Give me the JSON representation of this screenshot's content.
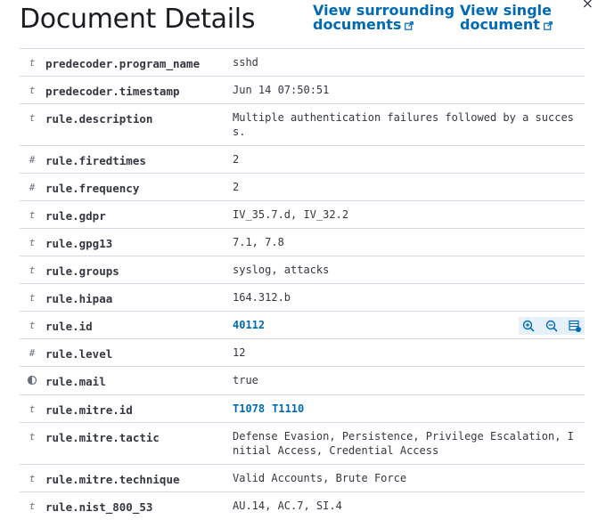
{
  "header": {
    "title": "Document Details",
    "surrounding_link_l1": "View surrounding",
    "surrounding_link_l2": "documents",
    "single_link_l1": "View single",
    "single_link_l2": "document",
    "close_label": "×"
  },
  "colors": {
    "link": "#006bb4",
    "divider": "#d3dae6",
    "text": "#343741"
  },
  "rows": [
    {
      "type": "t",
      "name": "predecoder.program_name",
      "value": "sshd"
    },
    {
      "type": "t",
      "name": "predecoder.timestamp",
      "value": "Jun 14 07:50:51"
    },
    {
      "type": "t",
      "name": "rule.description",
      "value": "Multiple authentication failures followed by a success."
    },
    {
      "type": "#",
      "name": "rule.firedtimes",
      "value": "2"
    },
    {
      "type": "#",
      "name": "rule.frequency",
      "value": "2"
    },
    {
      "type": "t",
      "name": "rule.gdpr",
      "value": "IV_35.7.d, IV_32.2"
    },
    {
      "type": "t",
      "name": "rule.gpg13",
      "value": "7.1, 7.8"
    },
    {
      "type": "t",
      "name": "rule.groups",
      "value": "syslog, attacks"
    },
    {
      "type": "t",
      "name": "rule.hipaa",
      "value": "164.312.b"
    },
    {
      "type": "t",
      "name": "rule.id",
      "value": "40112",
      "actions": [
        "filter-for-value-icon",
        "filter-out-value-icon",
        "toggle-column-icon"
      ]
    },
    {
      "type": "#",
      "name": "rule.level",
      "value": "12"
    },
    {
      "type": "bool",
      "name": "rule.mail",
      "value": "true"
    },
    {
      "type": "t",
      "name": "rule.mitre.id",
      "values": [
        "T1078",
        "T1110"
      ]
    },
    {
      "type": "t",
      "name": "rule.mitre.tactic",
      "value": "Defense Evasion, Persistence, Privilege Escalation, Initial Access, Credential Access"
    },
    {
      "type": "t",
      "name": "rule.mitre.technique",
      "value": "Valid Accounts, Brute Force"
    },
    {
      "type": "t",
      "name": "rule.nist_800_53",
      "value": "AU.14, AC.7, SI.4"
    }
  ]
}
